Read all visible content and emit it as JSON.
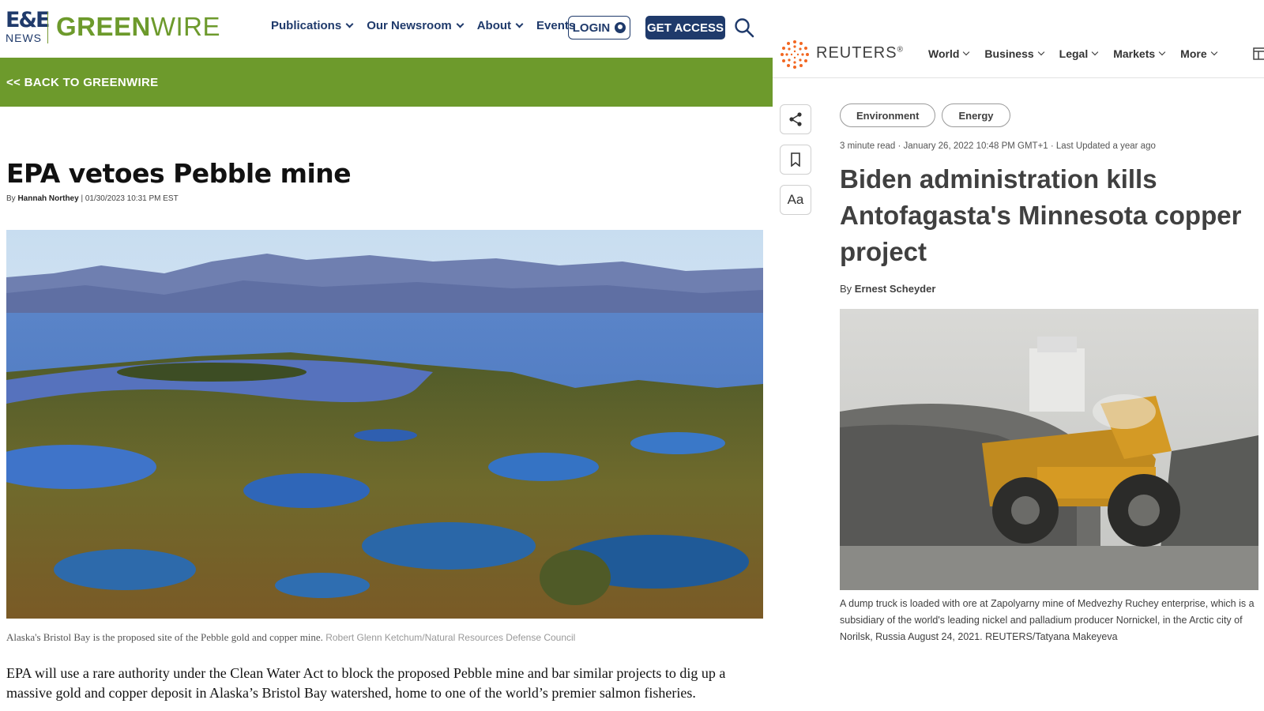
{
  "left": {
    "logo": {
      "mark": "E&E",
      "sub": "NEWS",
      "brand_bold": "GREEN",
      "brand_thin": "WIRE"
    },
    "nav": [
      {
        "label": "Publications",
        "dropdown": true
      },
      {
        "label": "Our Newsroom",
        "dropdown": true
      },
      {
        "label": "About",
        "dropdown": true
      },
      {
        "label": "Events",
        "dropdown": false
      }
    ],
    "login_label": "LOGIN",
    "access_label": "GET ACCESS",
    "back_label": "<< BACK TO GREENWIRE",
    "title": "EPA vetoes Pebble mine",
    "byline": {
      "prefix": "By",
      "author": "Hannah Northey",
      "date": "| 01/30/2023 10:31 PM EST"
    },
    "caption": "Alaska's Bristol Bay is the proposed site of the Pebble gold and copper mine.",
    "credit": "Robert Glenn Ketchum/Natural Resources Defense Council",
    "body": "EPA will use a rare authority under the Clean Water Act to block the proposed Pebble mine and bar similar projects to dig up a massive gold and copper deposit in Alaska’s Bristol Bay watershed, home to one of the world’s premier salmon fisheries.",
    "colors": {
      "brand_green": "#6d9a2c",
      "navy": "#1f3a6b"
    },
    "icons": [
      "search-icon",
      "user-icon"
    ]
  },
  "right": {
    "brand": "REUTERS",
    "brand_mark": "®",
    "nav": [
      {
        "label": "World"
      },
      {
        "label": "Business"
      },
      {
        "label": "Legal"
      },
      {
        "label": "Markets"
      },
      {
        "label": "More"
      }
    ],
    "tools": {
      "aa_label": "Aa"
    },
    "tags": [
      "Environment",
      "Energy"
    ],
    "meta": "3 minute read · January 26, 2022 10:48 PM GMT+1 · Last Updated a year ago",
    "title": "Biden administration kills Antofagasta's Minnesota copper project",
    "author_prefix": "By",
    "author": "Ernest Scheyder",
    "caption": "A dump truck is loaded with ore at Zapolyarny mine of Medvezhy Ruchey enterprise, which is a subsidiary of the world's leading nickel and palladium producer Nornickel, in the Arctic city of Norilsk, Russia August 24, 2021. REUTERS/Tatyana Makeyeva",
    "colors": {
      "brand_orange": "#f26722",
      "text_gray": "#404040"
    },
    "icons": [
      "share-icon",
      "bookmark-icon",
      "layout-icon",
      "chevron-down-icon"
    ]
  }
}
